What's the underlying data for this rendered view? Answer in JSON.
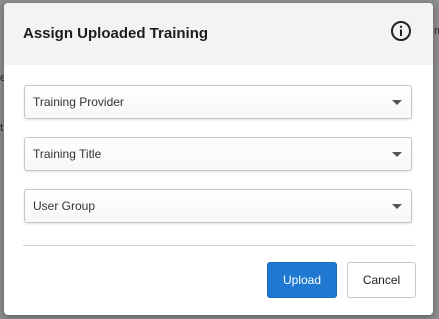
{
  "backdrop": {
    "fragments": [
      "m",
      "e",
      "t"
    ]
  },
  "dialog": {
    "title": "Assign Uploaded Training",
    "info_icon": "info-icon",
    "fields": [
      {
        "label": "Training Provider"
      },
      {
        "label": "Training Title"
      },
      {
        "label": "User Group"
      }
    ],
    "buttons": {
      "upload": "Upload",
      "cancel": "Cancel"
    }
  },
  "colors": {
    "primary": "#1f78d1",
    "header_bg": "#f4f3f2",
    "backdrop": "#8e8e8e"
  }
}
